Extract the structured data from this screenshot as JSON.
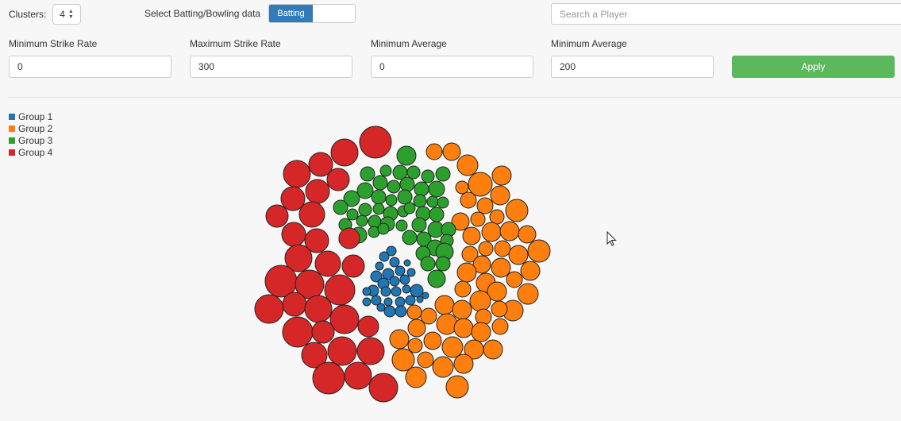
{
  "controls": {
    "clusters_label": "Clusters:",
    "clusters_value": "4",
    "data_type_label": "Select Batting/Bowling data",
    "toggle_on_label": "Batting",
    "search_placeholder": "Search a Player",
    "apply_label": "Apply"
  },
  "filters": [
    {
      "label": "Minimum Strike Rate",
      "value": "0"
    },
    {
      "label": "Maximum Strike Rate",
      "value": "300"
    },
    {
      "label": "Minimum Average",
      "value": "0"
    },
    {
      "label": "Minimum Average",
      "value": "200"
    }
  ],
  "legend": [
    {
      "label": "Group 1",
      "color": "#1f77b4"
    },
    {
      "label": "Group 2",
      "color": "#ff7f0e"
    },
    {
      "label": "Group 3",
      "color": "#2ca02c"
    },
    {
      "label": "Group 4",
      "color": "#d62728"
    }
  ]
}
